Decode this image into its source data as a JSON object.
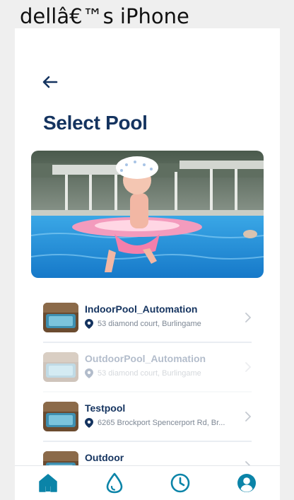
{
  "device": {
    "title": "dellâ€™s iPhone"
  },
  "header": {
    "title": "Select Pool"
  },
  "pools": [
    {
      "name": "IndoorPool_Automation",
      "address": "53 diamond court, Burlingame",
      "disabled": false
    },
    {
      "name": "OutdoorPool_Automation",
      "address": "53 diamond court, Burlingame",
      "disabled": true
    },
    {
      "name": "Testpool",
      "address": "6265 Brockport Spencerport Rd, Br...",
      "disabled": false
    },
    {
      "name": "Outdoor",
      "address": "",
      "disabled": false
    }
  ],
  "tabbar": {
    "items": [
      "home-icon",
      "water-drop-icon",
      "clock-icon",
      "user-icon"
    ]
  },
  "colors": {
    "primary": "#14335f",
    "accent": "#0b84a8",
    "background": "#efefef"
  }
}
